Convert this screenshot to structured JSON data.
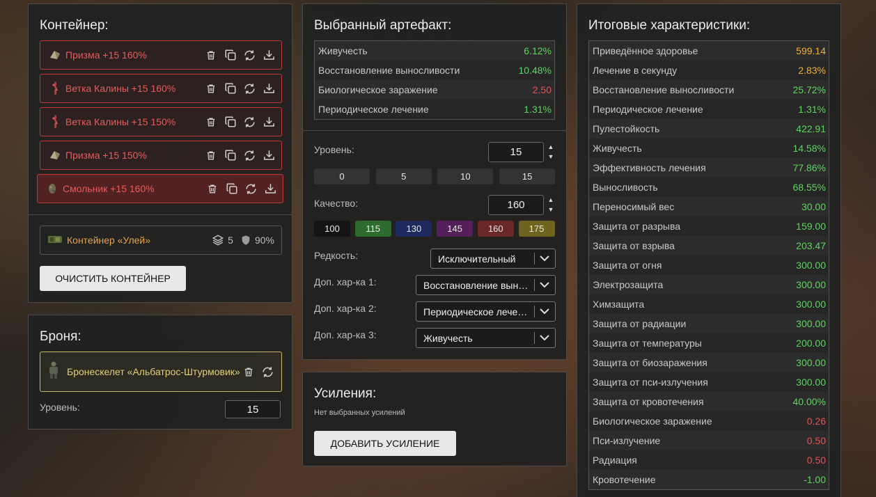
{
  "container": {
    "title": "Контейнер:",
    "artifacts": [
      {
        "name": "Призма +15 160%"
      },
      {
        "name": "Ветка Калины +15 160%"
      },
      {
        "name": "Ветка Калины +15 150%"
      },
      {
        "name": "Призма +15 150%"
      },
      {
        "name": "Смольник +15 160%"
      }
    ],
    "current": {
      "name": "Контейнер «Улей»",
      "slots": "5",
      "protection": "90%"
    },
    "clear_label": "ОЧИСТИТЬ КОНТЕЙНЕР"
  },
  "armor": {
    "title": "Броня:",
    "name": "Бронескелет «Альбатрос-Штурмовик»",
    "level_label": "Уровень:",
    "level_value": "15"
  },
  "artifact": {
    "title": "Выбранный артефакт:",
    "stats": [
      {
        "name": "Живучесть",
        "value": "6.12%",
        "color": "green"
      },
      {
        "name": "Восстановление выносливости",
        "value": "10.48%",
        "color": "green"
      },
      {
        "name": "Биологическое заражение",
        "value": "2.50",
        "color": "red"
      },
      {
        "name": "Периодическое лечение",
        "value": "1.31%",
        "color": "green"
      }
    ],
    "level_label": "Уровень:",
    "level_value": "15",
    "level_presets": [
      "0",
      "5",
      "10",
      "15"
    ],
    "quality_label": "Качество:",
    "quality_value": "160",
    "quality_presets": [
      {
        "label": "100",
        "color": "#141414"
      },
      {
        "label": "115",
        "color": "#2e6b2e"
      },
      {
        "label": "130",
        "color": "#1e2a5e"
      },
      {
        "label": "145",
        "color": "#55205a"
      },
      {
        "label": "160",
        "color": "#6a2727"
      },
      {
        "label": "175",
        "color": "#6e6420"
      }
    ],
    "rarity_label": "Редкость:",
    "rarity_value": "Исключительный",
    "extra1_label": "Доп. хар-ка 1:",
    "extra1_value": "Восстановление выносливости",
    "extra2_label": "Доп. хар-ка 2:",
    "extra2_value": "Периодическое лечение",
    "extra3_label": "Доп. хар-ка 3:",
    "extra3_value": "Живучесть"
  },
  "boosts": {
    "title": "Усиления:",
    "empty_text": "Нет выбранных усилений",
    "add_label": "ДОБАВИТЬ УСИЛЕНИЕ"
  },
  "totals": {
    "title": "Итоговые характеристики:",
    "stats": [
      {
        "name": "Приведённое здоровье",
        "value": "599.14",
        "color": "orange"
      },
      {
        "name": "Лечение в секунду",
        "value": "2.83%",
        "color": "orange"
      },
      {
        "name": "Восстановление выносливости",
        "value": "25.72%",
        "color": "green"
      },
      {
        "name": "Периодическое лечение",
        "value": "1.31%",
        "color": "green"
      },
      {
        "name": "Пулестойкость",
        "value": "422.91",
        "color": "green"
      },
      {
        "name": "Живучесть",
        "value": "14.58%",
        "color": "green"
      },
      {
        "name": "Эффективность лечения",
        "value": "77.86%",
        "color": "green"
      },
      {
        "name": "Выносливость",
        "value": "68.55%",
        "color": "green"
      },
      {
        "name": "Переносимый вес",
        "value": "30.00",
        "color": "green"
      },
      {
        "name": "Защита от разрыва",
        "value": "159.00",
        "color": "green"
      },
      {
        "name": "Защита от взрыва",
        "value": "203.47",
        "color": "green"
      },
      {
        "name": "Защита от огня",
        "value": "300.00",
        "color": "green"
      },
      {
        "name": "Электрозащита",
        "value": "300.00",
        "color": "green"
      },
      {
        "name": "Химзащита",
        "value": "300.00",
        "color": "green"
      },
      {
        "name": "Защита от радиации",
        "value": "300.00",
        "color": "green"
      },
      {
        "name": "Защита от температуры",
        "value": "200.00",
        "color": "green"
      },
      {
        "name": "Защита от биозаражения",
        "value": "300.00",
        "color": "green"
      },
      {
        "name": "Защита от пси-излучения",
        "value": "300.00",
        "color": "green"
      },
      {
        "name": "Защита от кровотечения",
        "value": "40.00%",
        "color": "green"
      },
      {
        "name": "Биологическое заражение",
        "value": "0.26",
        "color": "red"
      },
      {
        "name": "Пси-излучение",
        "value": "0.50",
        "color": "red"
      },
      {
        "name": "Радиация",
        "value": "0.50",
        "color": "red"
      },
      {
        "name": "Кровотечение",
        "value": "-1.00",
        "color": "green"
      }
    ]
  }
}
